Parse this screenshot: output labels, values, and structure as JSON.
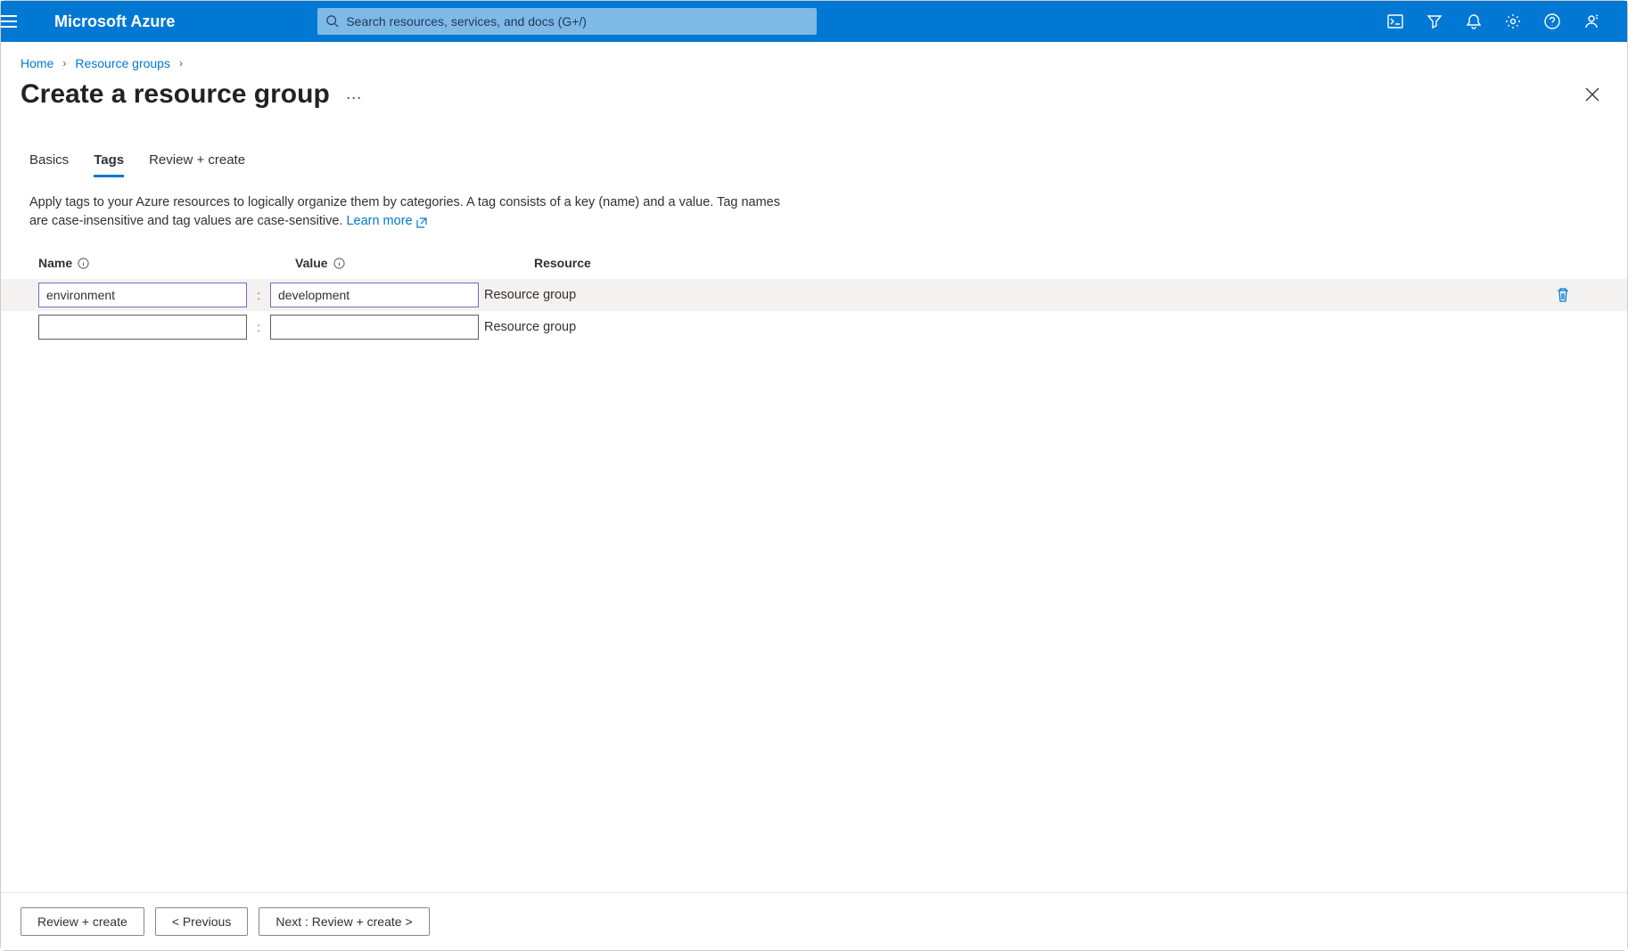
{
  "brand": "Microsoft Azure",
  "search": {
    "placeholder": "Search resources, services, and docs (G+/)"
  },
  "breadcrumbs": {
    "home": "Home",
    "rg": "Resource groups"
  },
  "page": {
    "title": "Create a resource group"
  },
  "tabs": {
    "basics": "Basics",
    "tags": "Tags",
    "review": "Review + create"
  },
  "desc": {
    "text": "Apply tags to your Azure resources to logically organize them by categories. A tag consists of a key (name) and a value. Tag names are case-insensitive and tag values are case-sensitive.",
    "learn_more": "Learn more"
  },
  "headers": {
    "name": "Name",
    "value": "Value",
    "resource": "Resource"
  },
  "rows": [
    {
      "name": "environment",
      "value": "development",
      "resource": "Resource group",
      "has_delete": true
    },
    {
      "name": "",
      "value": "",
      "resource": "Resource group",
      "has_delete": false
    }
  ],
  "footer": {
    "review": "Review + create",
    "prev": "< Previous",
    "next": "Next : Review + create >"
  }
}
